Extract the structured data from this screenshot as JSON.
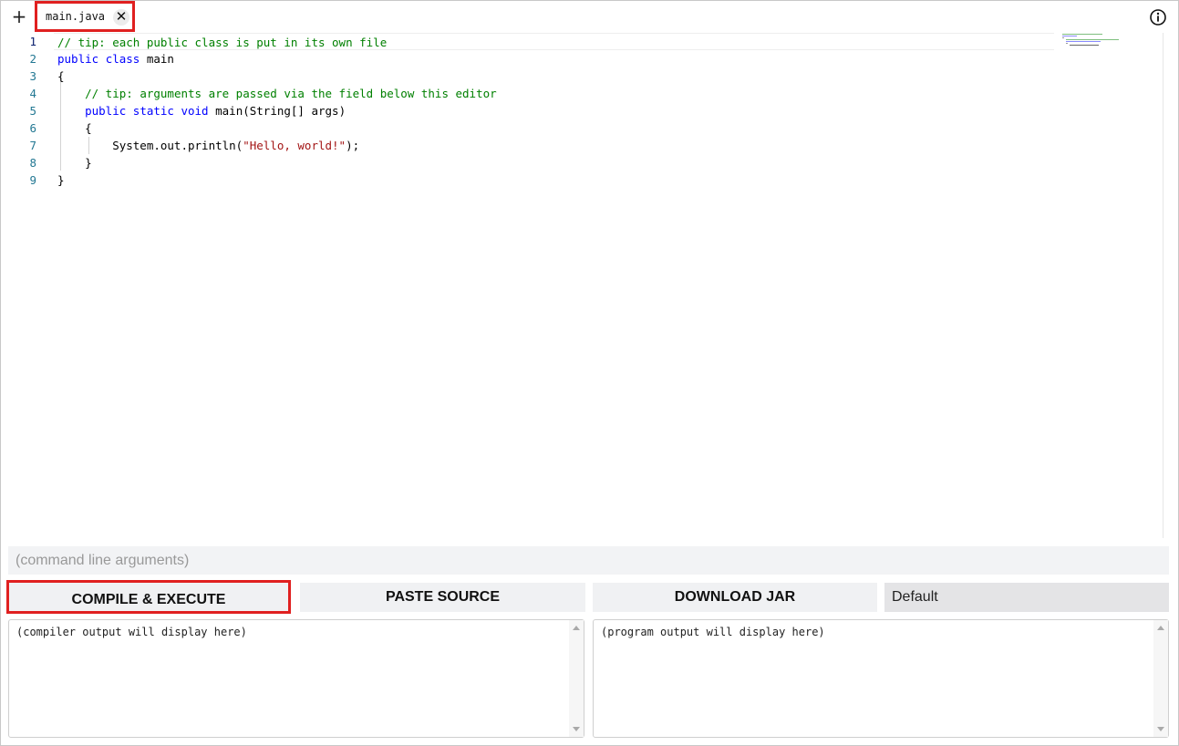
{
  "tabs": {
    "add_label": "+",
    "items": [
      {
        "label": "main.java",
        "close_label": "✕"
      }
    ]
  },
  "info_icon": "info-circle-icon",
  "editor": {
    "line_numbers": [
      "1",
      "2",
      "3",
      "4",
      "5",
      "6",
      "7",
      "8",
      "9"
    ],
    "lines": [
      [
        {
          "t": "cm",
          "v": "// tip: each public class is put in its own file"
        }
      ],
      [
        {
          "t": "kw",
          "v": "public"
        },
        {
          "t": "tx",
          "v": " "
        },
        {
          "t": "kw",
          "v": "class"
        },
        {
          "t": "tx",
          "v": " main"
        }
      ],
      [
        {
          "t": "tx",
          "v": "{"
        }
      ],
      [
        {
          "t": "tx",
          "v": "    "
        },
        {
          "t": "cm",
          "v": "// tip: arguments are passed via the field below this editor"
        }
      ],
      [
        {
          "t": "tx",
          "v": "    "
        },
        {
          "t": "kw",
          "v": "public"
        },
        {
          "t": "tx",
          "v": " "
        },
        {
          "t": "kw",
          "v": "static"
        },
        {
          "t": "tx",
          "v": " "
        },
        {
          "t": "kw",
          "v": "void"
        },
        {
          "t": "tx",
          "v": " main(String[] args)"
        }
      ],
      [
        {
          "t": "tx",
          "v": "    {"
        }
      ],
      [
        {
          "t": "tx",
          "v": "        System.out.println("
        },
        {
          "t": "st",
          "v": "\"Hello, world!\""
        },
        {
          "t": "tx",
          "v": ");"
        }
      ],
      [
        {
          "t": "tx",
          "v": "    }"
        }
      ],
      [
        {
          "t": "tx",
          "v": "}"
        }
      ]
    ]
  },
  "args": {
    "placeholder": "(command line arguments)"
  },
  "buttons": {
    "compile": "COMPILE & EXECUTE",
    "paste": "PASTE SOURCE",
    "download": "DOWNLOAD JAR"
  },
  "select": {
    "selected": "Default"
  },
  "outputs": {
    "compiler": "(compiler output will display here)",
    "program": "(program output will display here)"
  },
  "colors": {
    "keyword": "#0000ff",
    "comment": "#008000",
    "string": "#a31515",
    "highlight_border": "#e02020"
  }
}
